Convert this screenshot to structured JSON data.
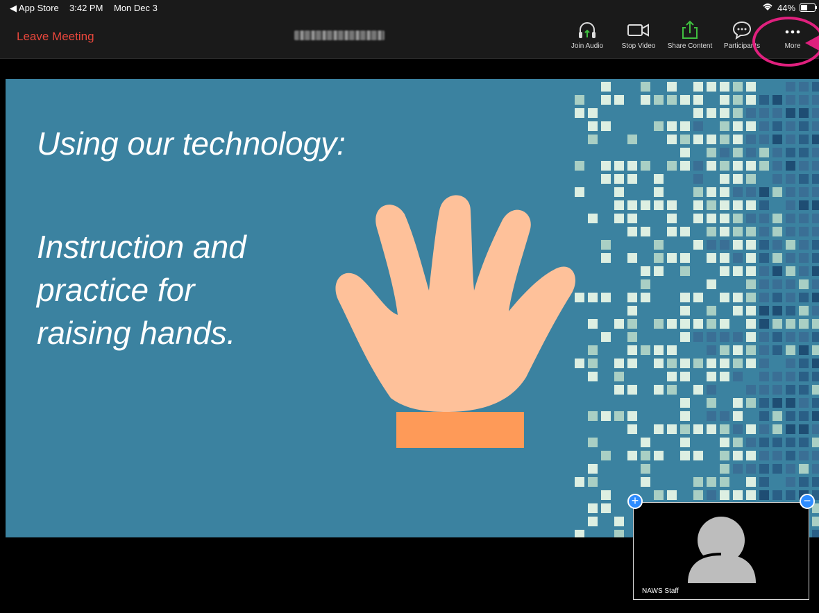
{
  "status": {
    "back_app": "◀ App Store",
    "time": "3:42 PM",
    "date": "Mon Dec 3",
    "battery": "44%"
  },
  "toolbar": {
    "leave_label": "Leave Meeting",
    "join_audio": "Join Audio",
    "stop_video": "Stop Video",
    "share_content": "Share Content",
    "participants": "Participants",
    "more": "More"
  },
  "slide": {
    "title": "Using our technology:",
    "body": "Instruction and\npractice for\nraising hands."
  },
  "video": {
    "participant_name": "NAWS Staff",
    "add_label": "+",
    "remove_label": "−"
  },
  "colors": {
    "leave_red": "#e8473c",
    "share_green": "#3fbf3f",
    "highlight_pink": "#e0207e",
    "slide_bg": "#3b82a0",
    "hand": "#fec19a",
    "bar": "#fe9a58",
    "zoom_blue": "#2d8cff"
  }
}
